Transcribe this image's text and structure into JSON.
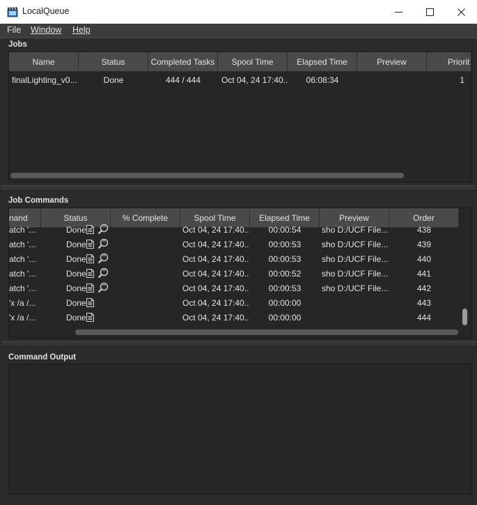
{
  "window": {
    "title": "LocalQueue",
    "minimize_glyph": "—",
    "maximize_glyph": "☐",
    "close_glyph": "✕"
  },
  "menu": {
    "file": "File",
    "window": "Window",
    "help": "Help"
  },
  "jobs": {
    "label": "Jobs",
    "headers": [
      "Name",
      "Status",
      "Completed Tasks",
      "Spool Time",
      "Elapsed Time",
      "Preview",
      "Priorit"
    ],
    "rows": [
      {
        "name": "finalLighting_v0...",
        "status": "Done",
        "completed": "444 / 444",
        "spool": "Oct 04, 24 17:40...",
        "elapsed": "06:08:34",
        "preview": "",
        "priority": "1"
      }
    ]
  },
  "commands": {
    "label": "Job Commands",
    "headers": [
      "nand",
      "Status",
      "% Complete",
      "Spool Time",
      "Elapsed Time",
      "Preview",
      "Order"
    ],
    "rows": [
      {
        "command": "atch '...",
        "status": "Done",
        "icons": [
          "document-icon",
          "magnifier-icon"
        ],
        "spool": "Oct 04, 24 17:40...",
        "elapsed": "00:00:54",
        "preview": "sho D:/UCF File...",
        "order": "438"
      },
      {
        "command": "atch '...",
        "status": "Done",
        "icons": [
          "document-icon",
          "magnifier-icon"
        ],
        "spool": "Oct 04, 24 17:40...",
        "elapsed": "00:00:53",
        "preview": "sho D:/UCF File...",
        "order": "439"
      },
      {
        "command": "atch '...",
        "status": "Done",
        "icons": [
          "document-icon",
          "magnifier-icon"
        ],
        "spool": "Oct 04, 24 17:40...",
        "elapsed": "00:00:53",
        "preview": "sho D:/UCF File...",
        "order": "440"
      },
      {
        "command": "atch '...",
        "status": "Done",
        "icons": [
          "document-icon",
          "magnifier-icon"
        ],
        "spool": "Oct 04, 24 17:40...",
        "elapsed": "00:00:52",
        "preview": "sho D:/UCF File...",
        "order": "441"
      },
      {
        "command": "atch '...",
        "status": "Done",
        "icons": [
          "document-icon",
          "magnifier-icon"
        ],
        "spool": "Oct 04, 24 17:40...",
        "elapsed": "00:00:53",
        "preview": "sho D:/UCF File...",
        "order": "442"
      },
      {
        "command": "'x /a /...",
        "status": "Done",
        "icons": [
          "document-icon"
        ],
        "spool": "Oct 04, 24 17:40...",
        "elapsed": "00:00:00",
        "preview": "",
        "order": "443"
      },
      {
        "command": "'x /a /...",
        "status": "Done",
        "icons": [
          "document-icon"
        ],
        "spool": "Oct 04, 24 17:40...",
        "elapsed": "00:00:00",
        "preview": "",
        "order": "444"
      }
    ]
  },
  "output": {
    "label": "Command Output",
    "text": ""
  },
  "colors": {
    "background": "#2b2b2b",
    "panel": "#262626",
    "header": "#4a4a4a",
    "titlebar": "#ffffff"
  }
}
